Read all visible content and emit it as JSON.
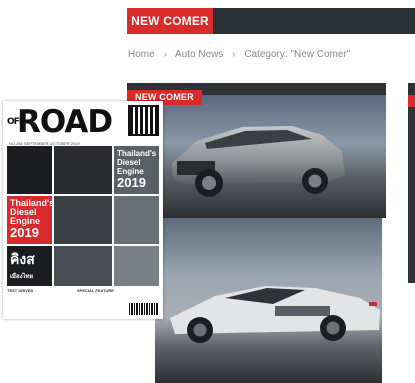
{
  "header": {
    "category_tag": "NEW COMER"
  },
  "breadcrumb": {
    "home": "Home",
    "sep": "›",
    "news": "Auto News",
    "current": "Category: \"New Comer\""
  },
  "cards": [
    {
      "badge": "NEW COMER"
    }
  ],
  "magazine": {
    "title_small": "OFF",
    "title": "ROAD",
    "issue": "NO.284 SEPTEMBER-OCTOBER 2019",
    "tile1_text": "Thailand's",
    "tile2_text": "Diesel",
    "tile3_text": "Engine",
    "tile_year": "2019",
    "red_tile_text1": "Thailand's",
    "red_tile_text2": "Diesel",
    "red_tile_text3": "Engine",
    "red_tile_year": "2019",
    "thai_tile_text": "คิงส",
    "thai_tile_sub": "เมืองไทย",
    "col1_head": "TEST DRIVES",
    "col2_head": "SPECIAL FEATURE"
  },
  "colors": {
    "accent": "#d92b2b",
    "header_dark": "#2b2f36"
  }
}
